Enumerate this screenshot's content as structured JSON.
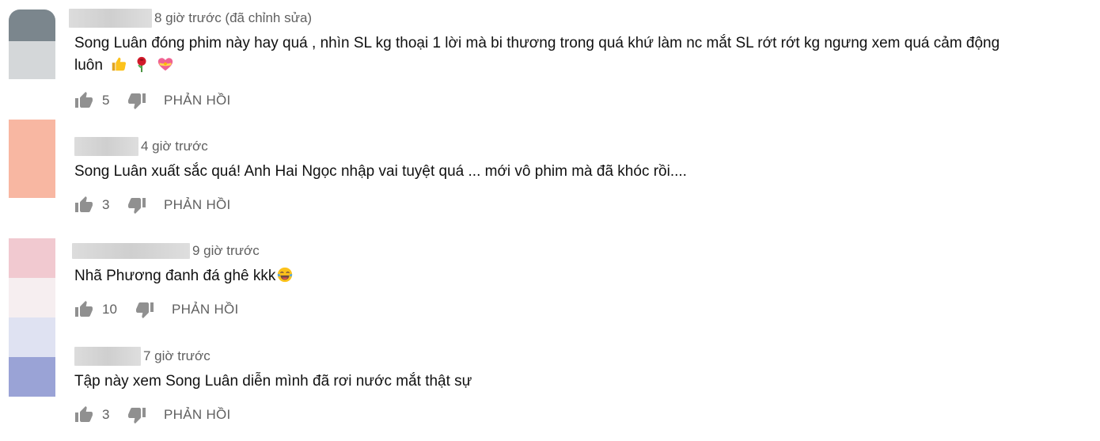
{
  "comments": [
    {
      "time": "8 giờ trước (đã chỉnh sửa)",
      "text_line1": "Song Luân đóng phim này hay quá , nhìn  SL kg thoại 1 lời  mà bi thương trong  quá khứ làm  nc mắt  SL rớt rớt kg ngưng xem quá cảm động",
      "text_line2": "luôn",
      "emojis": [
        "thumbs-up-emoji",
        "rose-emoji",
        "heart-with-ribbon-emoji"
      ],
      "likes": "5",
      "reply_label": "PHẢN HỒI"
    },
    {
      "time": "4 giờ trước",
      "text_line1": "Song Luân xuất sắc quá! Anh Hai Ngọc nhập vai tuyệt quá ... mới vô phim mà đã khóc rồi....",
      "likes": "3",
      "reply_label": "PHẢN HỒI"
    },
    {
      "time": "9 giờ trước",
      "text_line1": "Nhã Phương đanh đá ghê kkk",
      "emojis": [
        "tears-of-joy-emoji"
      ],
      "likes": "10",
      "reply_label": "PHẢN HỒI"
    },
    {
      "time": "7 giờ trước",
      "text_line1": "Tập này xem Song Luân diễn mình đã rơi nước mắt thật sự",
      "likes": "3",
      "reply_label": "PHẢN HỒI"
    }
  ],
  "colors": {
    "avatar_1": "#7b868d",
    "avatar_2": "#f8b7a2",
    "avatar_3": "#f1c9d0",
    "avatar_4": "#9aa3d6",
    "meta_text": "#606060",
    "comment_text": "#111111"
  }
}
